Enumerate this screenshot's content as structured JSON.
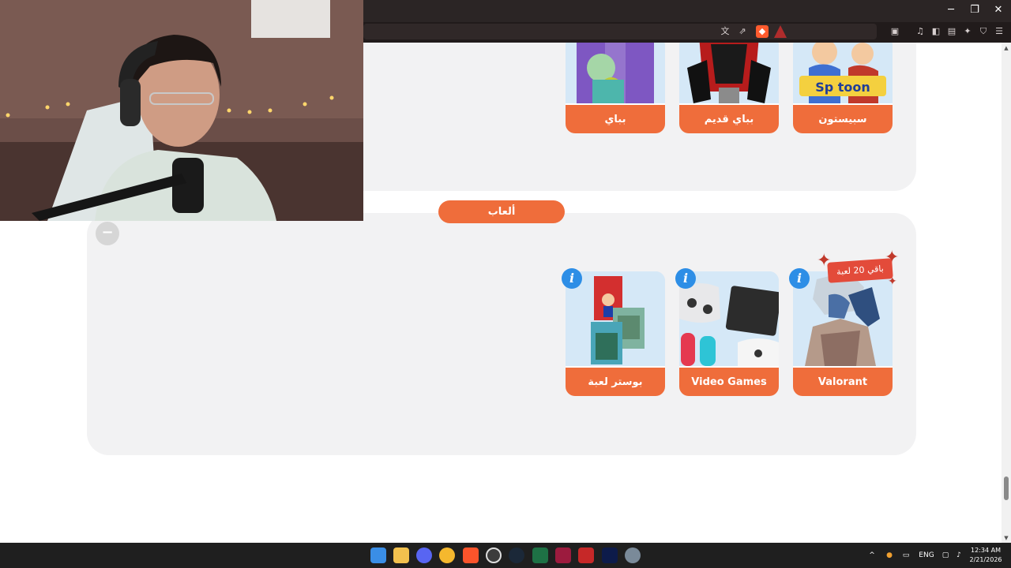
{
  "window": {
    "minimize": "─",
    "maximize": "❐",
    "close": "✕"
  },
  "toolbar_icons": [
    "translate-icon",
    "share-icon",
    "brave-shield-icon",
    "brave-rewards-icon",
    "tab-search-icon",
    "media-icon",
    "sidebar-icon",
    "wallet-icon",
    "leo-ai-icon",
    "vpn-icon",
    "menu-icon"
  ],
  "cartoons_section": {
    "cards": [
      {
        "label": "سبيستون",
        "art": "spacetoon-art"
      },
      {
        "label": "بباي قديم",
        "art": "old-popeye-art"
      },
      {
        "label": "بباي",
        "art": "popeye-art"
      }
    ]
  },
  "games_section": {
    "title": "ألعاب",
    "collapse_symbol": "−",
    "remaining_badge": "باقي 20 لعبة",
    "info_symbol": "i",
    "cards": [
      {
        "label": "Valorant",
        "art": "valorant-agent-art"
      },
      {
        "label": "Video Games",
        "art": "controllers-keyboard-art"
      },
      {
        "label": "بوستر لعبة",
        "art": "game-posters-art"
      }
    ]
  },
  "taskbar": {
    "apps": [
      "start-icon",
      "file-explorer-icon",
      "discord-icon",
      "discord-canary-icon",
      "brave-icon",
      "obs-icon",
      "steam-icon",
      "excel-icon",
      "arabic-app-icon",
      "red-app-icon",
      "dark-app-icon",
      "settings-icon"
    ],
    "language": "ENG",
    "time": "12:34 AM",
    "date": "2/21/2026"
  },
  "colors": {
    "accent_orange": "#ef6d3b",
    "panel_bg": "#f2f2f3",
    "info_blue": "#2d8ee6",
    "badge_red": "#e34b3a"
  }
}
